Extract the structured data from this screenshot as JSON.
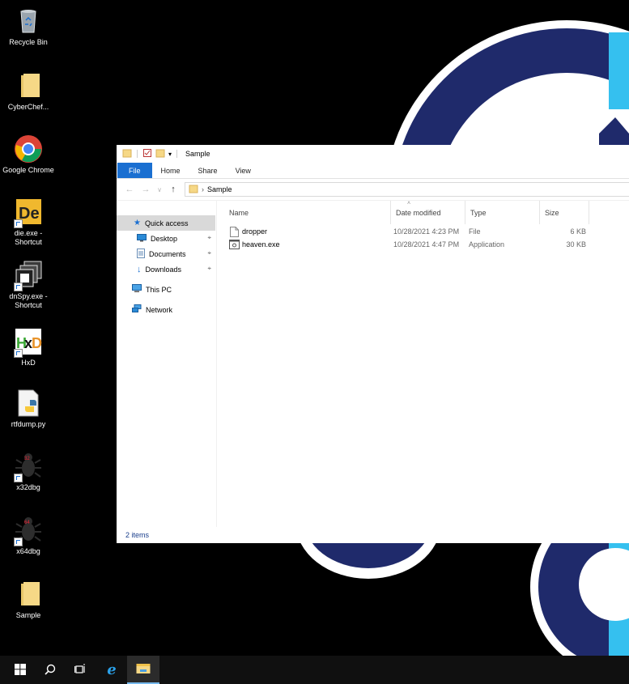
{
  "desktop": {
    "icons": [
      {
        "label": "Recycle Bin",
        "icon": "recycle-bin-icon"
      },
      {
        "label": "CyberChef...",
        "icon": "folder-icon"
      },
      {
        "label": "Google Chrome",
        "icon": "chrome-icon"
      },
      {
        "label": "die.exe - Shortcut",
        "icon": "die-icon"
      },
      {
        "label": "dnSpy.exe - Shortcut",
        "icon": "dnspy-icon"
      },
      {
        "label": "HxD",
        "icon": "hxd-icon"
      },
      {
        "label": "rtfdump.py",
        "icon": "python-script-icon"
      },
      {
        "label": "x32dbg",
        "icon": "x32dbg-icon"
      },
      {
        "label": "x64dbg",
        "icon": "x64dbg-icon"
      },
      {
        "label": "Sample",
        "icon": "folder-icon"
      }
    ]
  },
  "explorer": {
    "title": "Sample",
    "ribbon": {
      "file": "File",
      "home": "Home",
      "share": "Share",
      "view": "View"
    },
    "address": {
      "crumb": "Sample"
    },
    "nav": {
      "quick_access": "Quick access",
      "desktop": "Desktop",
      "documents": "Documents",
      "downloads": "Downloads",
      "this_pc": "This PC",
      "network": "Network"
    },
    "columns": {
      "name": "Name",
      "date": "Date modified",
      "type": "Type",
      "size": "Size"
    },
    "files": [
      {
        "name": "dropper",
        "date": "10/28/2021 4:23 PM",
        "type": "File",
        "size": "6 KB",
        "icon": "file-icon"
      },
      {
        "name": "heaven.exe",
        "date": "10/28/2021 4:47 PM",
        "type": "Application",
        "size": "30 KB",
        "icon": "exe-icon"
      }
    ],
    "status": "2 items"
  },
  "taskbar": {
    "items": [
      "windows-start-icon",
      "search-icon",
      "task-view-icon",
      "internet-explorer-icon",
      "file-explorer-icon"
    ]
  },
  "colors": {
    "accent": "#1a6fd1",
    "wallpaper_navy": "#1f2a6b",
    "wallpaper_cyan": "#35c0ef"
  }
}
